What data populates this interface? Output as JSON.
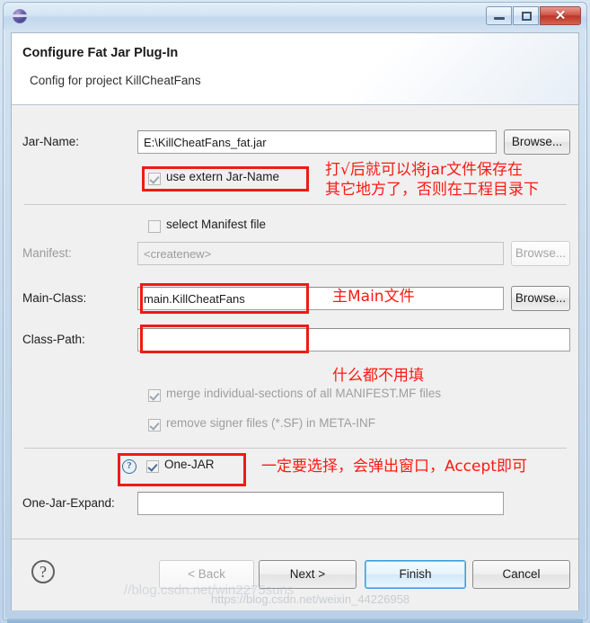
{
  "window": {
    "icon": "globe-icon",
    "buttons": {
      "minimize": "minimize-icon",
      "maximize": "maximize-icon",
      "close": "✕"
    }
  },
  "header": {
    "title": "Configure Fat Jar Plug-In",
    "subtitle": "Config for project KillCheatFans"
  },
  "form": {
    "jar_name": {
      "label": "Jar-Name:",
      "value": "E:\\KillCheatFans_fat.jar",
      "browse": "Browse..."
    },
    "use_extern": {
      "label": "use extern Jar-Name",
      "checked": true
    },
    "select_manifest": {
      "label": "select Manifest file",
      "checked": false
    },
    "manifest": {
      "label": "Manifest:",
      "value": "<createnew>",
      "browse": "Browse..."
    },
    "main_class": {
      "label": "Main-Class:",
      "value": "main.KillCheatFans",
      "browse": "Browse..."
    },
    "class_path": {
      "label": "Class-Path:",
      "value": ""
    },
    "merge_sections": {
      "label": "merge individual-sections of all MANIFEST.MF files",
      "checked": true
    },
    "remove_signer": {
      "label": "remove signer files (*.SF) in META-INF",
      "checked": true
    },
    "one_jar": {
      "label": "One-JAR",
      "checked": true,
      "help": "?"
    },
    "one_jar_expand": {
      "label": "One-Jar-Expand:",
      "value": ""
    }
  },
  "footer": {
    "help": "?",
    "back": "< Back",
    "next": "Next >",
    "finish": "Finish",
    "cancel": "Cancel"
  },
  "annotations": {
    "jar_name_line1": "打√后就可以将jar文件保存在",
    "jar_name_line2": "其它地方了，否则在工程目录下",
    "main_class": "主Main文件",
    "class_path": "什么都不用填",
    "one_jar": "一定要选择，会弹出窗口，Accept即可"
  },
  "watermarks": {
    "top": "//blog.csdn.net/win2275suns",
    "bottom": "https://blog.csdn.net/weixin_44226958"
  },
  "colors": {
    "annotation_red": "#fb1a13",
    "highlight_box": "#ee1b15",
    "default_button_border": "#3c9bdb"
  }
}
